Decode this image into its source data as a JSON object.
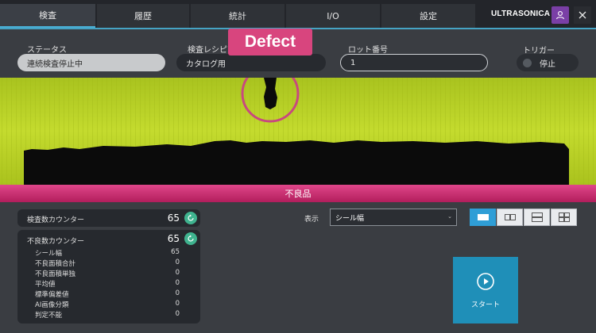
{
  "tabs": [
    {
      "label": "検査",
      "active": true
    },
    {
      "label": "履歴",
      "active": false
    },
    {
      "label": "統計",
      "active": false
    },
    {
      "label": "I/O",
      "active": false
    },
    {
      "label": "設定",
      "active": false
    }
  ],
  "brand": "ULTRASONICA",
  "header_icons": {
    "user": "user-icon",
    "close": "close-icon"
  },
  "fields": {
    "status": {
      "label": "ステータス",
      "value": "連続検査停止中"
    },
    "recipe": {
      "label": "検査レシピ",
      "value": "カタログ用"
    },
    "lot": {
      "label": "ロット番号",
      "value": "1"
    },
    "trigger": {
      "label": "トリガー",
      "value": "停止"
    }
  },
  "defect_tag": "Defect",
  "result_banner": "不良品",
  "inspection_counter": {
    "label": "検査数カウンター",
    "value": "65"
  },
  "defect_counter": {
    "label": "不良数カウンター",
    "value": "65",
    "items": [
      {
        "label": "シール幅",
        "value": "65"
      },
      {
        "label": "不良面積合計",
        "value": "0"
      },
      {
        "label": "不良面積単独",
        "value": "0"
      },
      {
        "label": "平均値",
        "value": "0"
      },
      {
        "label": "標準偏差値",
        "value": "0"
      },
      {
        "label": "AI画像分類",
        "value": "0"
      },
      {
        "label": "判定不能",
        "value": "0"
      }
    ]
  },
  "display": {
    "label": "表示",
    "selected": "シール幅"
  },
  "layout_options": [
    "single-view-icon",
    "two-column-icon",
    "two-row-icon",
    "grid-four-icon"
  ],
  "start_label": "スタート",
  "colors": {
    "accent": "#2f9ed6",
    "defect": "#d8457e",
    "reset": "#3fb38f",
    "user": "#7a3fa6",
    "seal": "#bfd72a"
  }
}
